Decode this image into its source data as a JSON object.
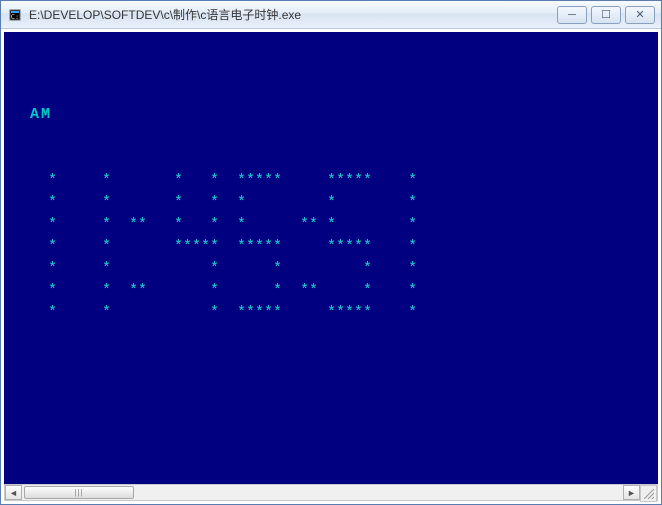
{
  "window": {
    "title": "E:\\DEVELOP\\SOFTDEV\\c\\制作\\c语言电子时钟.exe"
  },
  "console": {
    "ampm": "AM",
    "digit_rows": [
      "    *     *       *   *  *****     *****    *",
      "    *     *       *   *  *         *        *",
      "    *     *  **   *   *  *      ** *        *",
      "    *     *       *****  *****     *****    *",
      "    *     *           *      *         *    *",
      "    *     *  **       *      *  **     *    *",
      "    *     *           *  *****     *****    *"
    ]
  },
  "time_value": "11:45:31",
  "buttons": {
    "minimize_glyph": "─",
    "maximize_glyph": "☐",
    "close_glyph": "✕",
    "scroll_left_glyph": "◄",
    "scroll_right_glyph": "►"
  }
}
